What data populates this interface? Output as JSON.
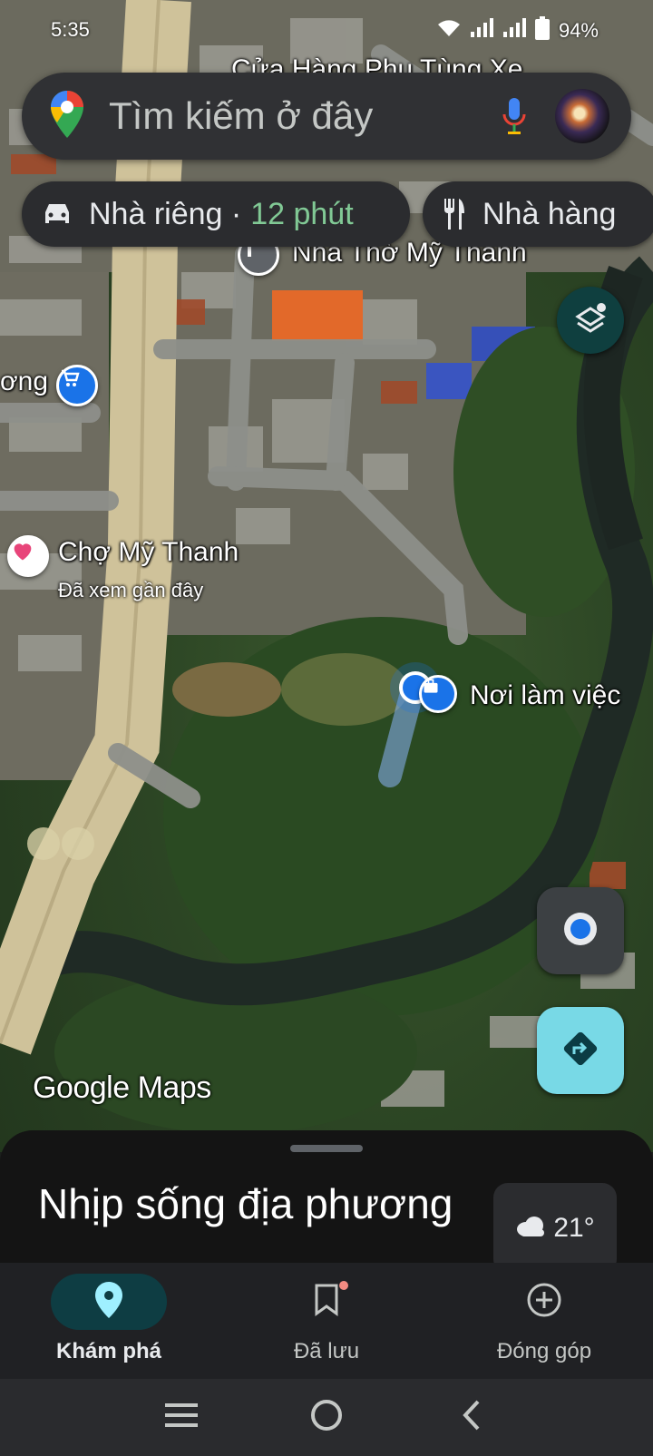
{
  "status_bar": {
    "time": "5:35",
    "battery": "94%"
  },
  "search": {
    "placeholder": "Tìm kiếm ở đây"
  },
  "chips": {
    "home": {
      "label": "Nhà riêng ·",
      "duration": "12 phút"
    },
    "restaurant": {
      "label": "Nhà hàng"
    }
  },
  "map": {
    "labels": {
      "top_shop": "Cửa Hàng Phụ Tùng Xe",
      "church": "Nhà Thờ Mỹ Thanh",
      "left_partial": "ơng",
      "market": "Chợ Mỹ Thanh",
      "market_sub": "Đã xem gần đây",
      "work": "Nơi làm việc"
    },
    "logo": "Google Maps"
  },
  "bottom_sheet": {
    "title": "Nhịp sống địa phương",
    "temperature": "21°"
  },
  "bottom_nav": [
    {
      "label": "Khám phá"
    },
    {
      "label": "Đã lưu"
    },
    {
      "label": "Đóng góp"
    }
  ],
  "colors": {
    "accent_green": "#81c995",
    "directions_bg": "#78d9e6",
    "active_nav_bg": "#0e3d43",
    "location_blue": "#1a73e8"
  }
}
